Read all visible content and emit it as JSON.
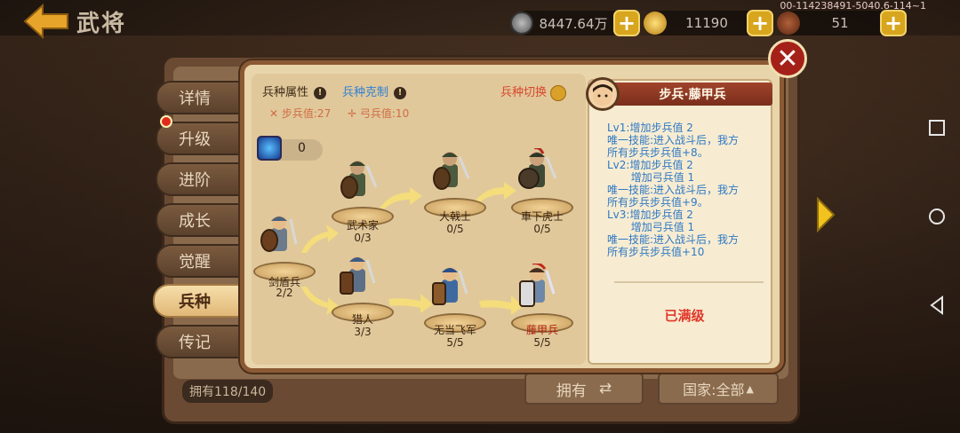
{
  "header": {
    "title": "武将",
    "build": "00-114238491-5040.6-114~1"
  },
  "resources": [
    {
      "name": "silver",
      "value": "8447.64万",
      "color": "#7a7a7a"
    },
    {
      "name": "gold",
      "value": "11190",
      "color": "#d9a02a"
    },
    {
      "name": "food",
      "value": "51",
      "color": "#7a3a22"
    }
  ],
  "tabs": [
    {
      "label": "详情",
      "active": false
    },
    {
      "label": "升级",
      "active": false
    },
    {
      "label": "进阶",
      "active": false
    },
    {
      "label": "成长",
      "active": false
    },
    {
      "label": "觉醒",
      "active": false
    },
    {
      "label": "兵种",
      "active": true
    },
    {
      "label": "传记",
      "active": false
    }
  ],
  "panel": {
    "attr_label": "兵种属性",
    "counter_label": "兵种克制",
    "switch_label": "兵种切换",
    "infantry_stat": "步兵值:27",
    "archer_stat": "弓兵值:10",
    "gem_count": "0"
  },
  "units": [
    {
      "name": "剑盾兵",
      "count": "2/2"
    },
    {
      "name": "武术家",
      "count": "0/3"
    },
    {
      "name": "大戟士",
      "count": "0/5"
    },
    {
      "name": "車下虎士",
      "count": "0/5"
    },
    {
      "name": "猎人",
      "count": "3/3"
    },
    {
      "name": "无当飞军",
      "count": "5/5"
    },
    {
      "name": "藤甲兵",
      "count": "5/5"
    }
  ],
  "detail": {
    "title": "步兵·藤甲兵",
    "description": "Lv1:增加步兵值 2\n唯一技能:进入战斗后，我方\n所有步兵步兵值+8。\nLv2:增加步兵值 2\n       增加弓兵值 1\n唯一技能:进入战斗后，我方\n所有步兵步兵值+9。\nLv3:增加步兵值 2\n       增加弓兵值 1\n唯一技能:进入战斗后，我方\n所有步兵步兵值+10",
    "status": "已满级"
  },
  "footer": {
    "owned": "拥有118/140",
    "own_button": "拥有",
    "country_button": "国家:全部"
  }
}
